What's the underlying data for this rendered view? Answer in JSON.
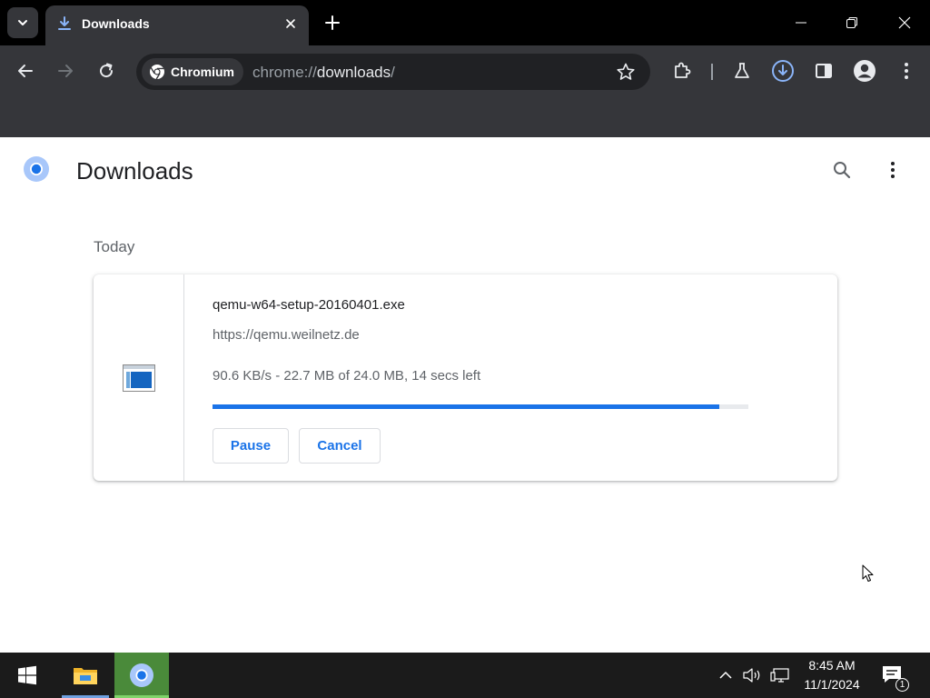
{
  "tab": {
    "title": "Downloads"
  },
  "omnibox": {
    "chip_label": "Chromium",
    "url_scheme": "chrome://",
    "url_host": "downloads",
    "url_path": "/"
  },
  "page": {
    "title": "Downloads",
    "section_date": "Today"
  },
  "download": {
    "filename": "qemu-w64-setup-20160401.exe",
    "source_url": "https://qemu.weilnetz.de",
    "status": "90.6 KB/s - 22.7 MB of 24.0 MB, 14 secs left",
    "progress_fraction": 0.946,
    "pause_label": "Pause",
    "cancel_label": "Cancel"
  },
  "taskbar": {
    "time": "8:45 AM",
    "date": "11/1/2024",
    "notification_count": "1"
  },
  "colors": {
    "accent": "#1a73e8",
    "frame": "#000000",
    "toolbar": "#35363a",
    "download_active": "#8ab4f8"
  }
}
